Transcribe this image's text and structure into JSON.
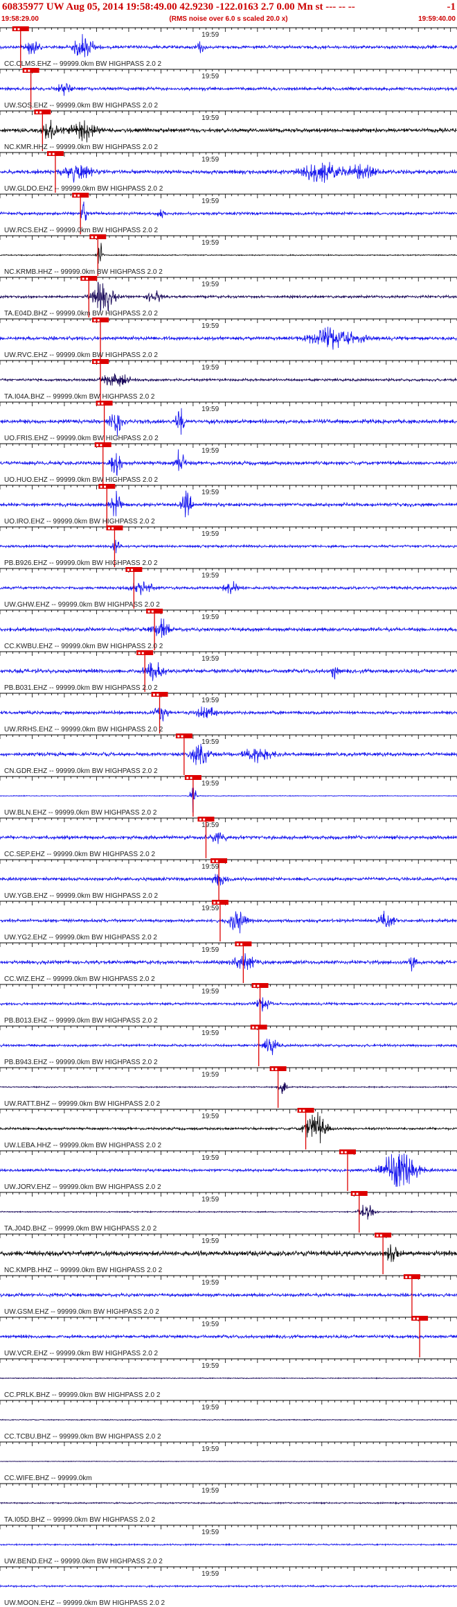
{
  "header": {
    "title": "60835977 UW Aug 05, 2014 19:58:49.00   42.9230 -122.0163  2.7 0.00 Mn st --- -- --",
    "title_right": "-1",
    "time_start": "19:58:29.00",
    "time_end": "19:59:40.00",
    "subtitle": "(RMS noise over 6.0 s scaled 20.0 x)"
  },
  "chart_data": {
    "type": "line",
    "title": "60835977 UW Aug 05, 2014 19:58:49.00   42.9230 -122.0163  2.7 0.00 Mn st --- -- --",
    "subtitle": "(RMS noise over 6.0 s scaled 20.0 x)",
    "time_start": "19:58:29.00",
    "time_end": "19:59:40.00",
    "time_tick_label": "19:59",
    "grid": false,
    "colors": {
      "trace_blue": "#1a1aee",
      "trace_black": "#111111",
      "trace_dark": "#1a0a5a",
      "pick": "#dd0000",
      "axis": "#000000"
    },
    "traces": [
      {
        "label": "CC.CLMS.EHZ -- 99999.0km BW  HIGHPASS  2.0  2",
        "color": "#1a1aee",
        "pick": 3.2,
        "amp": 0.45,
        "bursts": [
          [
            5,
            2.4,
            1.0
          ],
          [
            13,
            3.0,
            1.5
          ],
          [
            31,
            2.0,
            0.5
          ]
        ]
      },
      {
        "label": "UW.SOS.EHZ -- 99999.0km BW  HIGHPASS  2.0  2",
        "color": "#1a1aee",
        "pick": 4.8,
        "amp": 0.45,
        "bursts": [
          [
            10,
            1.5,
            1.0
          ]
        ]
      },
      {
        "label": "NC.KMR.HHZ -- 99999.0km BW  HIGHPASS  2.0  2",
        "color": "#111111",
        "pick": 6.6,
        "amp": 0.55,
        "bursts": [
          [
            8,
            2.8,
            1.2
          ],
          [
            13,
            2.6,
            1.8
          ]
        ]
      },
      {
        "label": "UW.GLDO.EHZ -- 99999.0km BW  HIGHPASS  2.0  2",
        "color": "#1a1aee",
        "pick": 8.6,
        "amp": 0.55,
        "bursts": [
          [
            12,
            2.2,
            2.0
          ],
          [
            50,
            2.5,
            3.0
          ],
          [
            56,
            2.0,
            2.0
          ]
        ]
      },
      {
        "label": "UW.RCS.EHZ -- 99999.0km BW  HIGHPASS  2.0  2",
        "color": "#1a1aee",
        "pick": 12.5,
        "amp": 0.4,
        "bursts": [
          [
            13,
            3.5,
            0.4
          ],
          [
            25,
            1.2,
            0.5
          ]
        ]
      },
      {
        "label": "NC.KRMB.HHZ -- 99999.0km BW  HIGHPASS  2.0  2",
        "color": "#111111",
        "pick": 15.2,
        "amp": 0.15,
        "bursts": [
          [
            15.5,
            4.0,
            0.4
          ]
        ]
      },
      {
        "label": "TA.E04D.BHZ -- 99999.0km BW  HIGHPASS  2.0  2",
        "color": "#1a0a5a",
        "pick": 13.8,
        "amp": 0.35,
        "bursts": [
          [
            16,
            4.5,
            1.5
          ],
          [
            24,
            1.8,
            1.0
          ]
        ]
      },
      {
        "label": "UW.RVC.EHZ -- 99999.0km BW  HIGHPASS  2.0  2",
        "color": "#1a1aee",
        "pick": 15.6,
        "amp": 0.5,
        "bursts": [
          [
            52,
            2.8,
            3.5
          ]
        ]
      },
      {
        "label": "TA.I04A.BHZ -- 99999.0km BW  HIGHPASS  2.0  2",
        "color": "#1a0a5a",
        "pick": 15.6,
        "amp": 0.35,
        "bursts": [
          [
            18,
            2.0,
            2.0
          ]
        ]
      },
      {
        "label": "UO.FRIS.EHZ -- 99999.0km BW  HIGHPASS  2.0  2",
        "color": "#1a1aee",
        "pick": 16.2,
        "amp": 0.55,
        "bursts": [
          [
            18,
            3.5,
            0.8
          ],
          [
            28,
            3.5,
            0.6
          ]
        ]
      },
      {
        "label": "UO.HUO.EHZ -- 99999.0km BW  HIGHPASS  2.0  2",
        "color": "#1a1aee",
        "pick": 16.0,
        "amp": 0.5,
        "bursts": [
          [
            18,
            3.0,
            0.8
          ],
          [
            28,
            3.8,
            0.6
          ]
        ]
      },
      {
        "label": "UO.IRO.EHZ -- 99999.0km BW  HIGHPASS  2.0  2",
        "color": "#1a1aee",
        "pick": 16.6,
        "amp": 0.5,
        "bursts": [
          [
            18,
            3.2,
            0.8
          ],
          [
            29,
            3.8,
            0.7
          ]
        ]
      },
      {
        "label": "PB.B926.EHZ -- 99999.0km BW  HIGHPASS  2.0  2",
        "color": "#1a1aee",
        "pick": 17.8,
        "amp": 0.35,
        "bursts": [
          [
            18,
            2.5,
            0.5
          ]
        ]
      },
      {
        "label": "UW.GHW.EHZ -- 99999.0km BW  HIGHPASS  2.0  2",
        "color": "#1a1aee",
        "pick": 20.8,
        "amp": 0.4,
        "bursts": [
          [
            22,
            1.8,
            1.5
          ],
          [
            36,
            1.6,
            1.2
          ]
        ]
      },
      {
        "label": "CC.KWBU.EHZ -- 99999.0km BW  HIGHPASS  2.0  2",
        "color": "#1a1aee",
        "pick": 24.0,
        "amp": 0.5,
        "bursts": [
          [
            25,
            2.5,
            1.2
          ]
        ]
      },
      {
        "label": "PB.B031.EHZ -- 99999.0km BW  HIGHPASS  2.0  2",
        "color": "#1a1aee",
        "pick": 22.5,
        "amp": 0.55,
        "bursts": [
          [
            24,
            3.2,
            1.2
          ],
          [
            52,
            1.8,
            0.5
          ]
        ]
      },
      {
        "label": "UW.RRHS.EHZ -- 99999.0km BW  HIGHPASS  2.0  2",
        "color": "#1a1aee",
        "pick": 24.8,
        "amp": 0.45,
        "bursts": [
          [
            25,
            2.2,
            1.0
          ],
          [
            32,
            1.5,
            1.5
          ]
        ]
      },
      {
        "label": "CN.GDR.EHZ -- 99999.0km BW  HIGHPASS  2.0  2",
        "color": "#1a1aee",
        "pick": 28.6,
        "amp": 0.5,
        "bursts": [
          [
            31,
            3.2,
            1.2
          ],
          [
            40,
            2.0,
            2.0
          ]
        ]
      },
      {
        "label": "UW.BLN.EHZ -- 99999.0km BW  HIGHPASS  2.0  2",
        "color": "#1a1aee",
        "pick": 30.0,
        "amp": 0.1,
        "bursts": [
          [
            30,
            4.5,
            0.4
          ]
        ]
      },
      {
        "label": "CC.SEP.EHZ -- 99999.0km BW  HIGHPASS  2.0  2",
        "color": "#1a1aee",
        "pick": 32.0,
        "amp": 0.5,
        "bursts": [
          [
            34,
            1.5,
            1.0
          ]
        ]
      },
      {
        "label": "UW.YGB.EHZ -- 99999.0km BW  HIGHPASS  2.0  2",
        "color": "#1a1aee",
        "pick": 34.0,
        "amp": 0.45,
        "bursts": [
          [
            34,
            1.6,
            1.0
          ]
        ]
      },
      {
        "label": "UW.YG2.EHZ -- 99999.0km BW  HIGHPASS  2.0  2",
        "color": "#1a1aee",
        "pick": 34.2,
        "amp": 0.45,
        "bursts": [
          [
            37,
            3.5,
            1.2
          ],
          [
            60,
            2.5,
            1.0
          ]
        ]
      },
      {
        "label": "CC.WIZ.EHZ -- 99999.0km BW  HIGHPASS  2.0  2",
        "color": "#1a1aee",
        "pick": 37.8,
        "amp": 0.5,
        "bursts": [
          [
            38,
            2.0,
            1.5
          ],
          [
            64,
            2.0,
            0.6
          ]
        ]
      },
      {
        "label": "PB.B013.EHZ -- 99999.0km BW  HIGHPASS  2.0  2",
        "color": "#1a1aee",
        "pick": 40.4,
        "amp": 0.35,
        "bursts": [
          [
            41,
            2.0,
            1.0
          ]
        ]
      },
      {
        "label": "PB.B943.EHZ -- 99999.0km BW  HIGHPASS  2.0  2",
        "color": "#1a1aee",
        "pick": 40.2,
        "amp": 0.35,
        "bursts": [
          [
            42,
            2.5,
            1.0
          ]
        ]
      },
      {
        "label": "UW.RATT.BHZ -- 99999.0km BW  HIGHPASS  2.0  2",
        "color": "#1a0a5a",
        "pick": 43.2,
        "amp": 0.15,
        "bursts": [
          [
            44,
            2.5,
            0.6
          ]
        ]
      },
      {
        "label": "UW.LEBA.HHZ -- 99999.0km BW  HIGHPASS  2.0  2",
        "color": "#111111",
        "pick": 47.5,
        "amp": 0.35,
        "bursts": [
          [
            49,
            4.5,
            1.5
          ]
        ]
      },
      {
        "label": "UW.JORV.EHZ -- 99999.0km BW  HIGHPASS  2.0  2",
        "color": "#1a1aee",
        "pick": 54.0,
        "amp": 0.4,
        "bursts": [
          [
            62,
            5.5,
            2.5
          ]
        ]
      },
      {
        "label": "TA.J04D.BHZ -- 99999.0km BW  HIGHPASS  2.0  2",
        "color": "#1a0a5a",
        "pick": 55.8,
        "amp": 0.15,
        "bursts": [
          [
            57,
            2.5,
            1.0
          ]
        ]
      },
      {
        "label": "NC.KMPB.HHZ -- 99999.0km BW  HIGHPASS  2.0  2",
        "color": "#111111",
        "pick": 59.5,
        "amp": 0.7,
        "bursts": [
          [
            61,
            3.2,
            0.8
          ]
        ]
      },
      {
        "label": "UW.GSM.EHZ -- 99999.0km BW  HIGHPASS  2.0  2",
        "color": "#1a1aee",
        "pick": 64.0,
        "amp": 0.45,
        "bursts": []
      },
      {
        "label": "UW.VCR.EHZ -- 99999.0km BW  HIGHPASS  2.0  2",
        "color": "#1a1aee",
        "pick": 65.2,
        "amp": 0.45,
        "bursts": []
      },
      {
        "label": "CC.PRLK.BHZ -- 99999.0km BW  HIGHPASS  2.0  2",
        "color": "#1a0a5a",
        "pick": null,
        "amp": 0.12,
        "bursts": []
      },
      {
        "label": "CC.TCBU.BHZ -- 99999.0km BW  HIGHPASS  2.0  2",
        "color": "#1a0a5a",
        "pick": null,
        "amp": 0.12,
        "bursts": []
      },
      {
        "label": "CC.WIFE.BHZ -- 99999.0km",
        "color": "#1a0a5a",
        "pick": null,
        "amp": 0.08,
        "bursts": []
      },
      {
        "label": "TA.I05D.BHZ -- 99999.0km BW  HIGHPASS  2.0  2",
        "color": "#1a0a5a",
        "pick": null,
        "amp": 0.18,
        "bursts": []
      },
      {
        "label": "UW.BEND.EHZ -- 99999.0km BW  HIGHPASS  2.0  2",
        "color": "#1a1aee",
        "pick": null,
        "amp": 0.2,
        "bursts": []
      },
      {
        "label": "UW.MOON.EHZ -- 99999.0km BW  HIGHPASS  2.0  2",
        "color": "#1a1aee",
        "pick": null,
        "amp": 0.25,
        "bursts": []
      }
    ]
  }
}
